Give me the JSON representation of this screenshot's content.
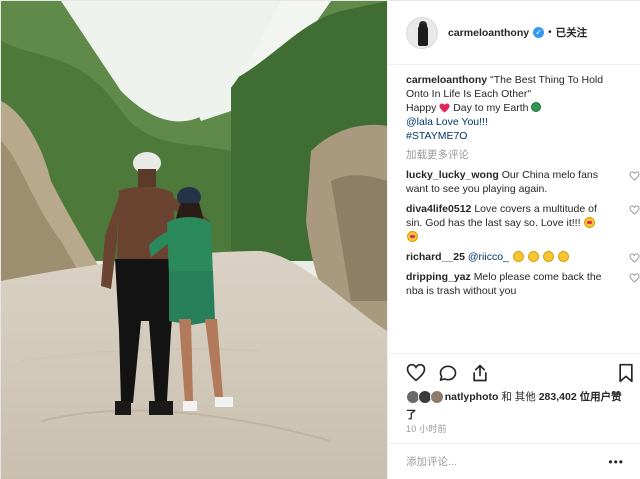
{
  "post": {
    "author": "carmeloanthony",
    "follow_status": "已关注",
    "caption": {
      "username": "carmeloanthony",
      "line1": "\"The Best Thing To Hold Onto In Life Is Each Other\"",
      "line2_pre": "Happy",
      "line2_post": "Day to my Earth",
      "mention_line": "@lala Love You!!!",
      "hashtag": "#STAYME7O"
    },
    "load_more": "加载更多评论",
    "comments": [
      {
        "username": "lucky_lucky_wong",
        "text": "Our China melo fans want to see you playing again."
      },
      {
        "username": "diva4life0512",
        "text": "Love covers a multitude of sin. God has the last say so. Love it!!!"
      },
      {
        "username": "richard__25",
        "mention": "@riicco_",
        "text": ""
      },
      {
        "username": "dripping_yaz",
        "text": "Melo please come back the nba is trash without you"
      }
    ],
    "likes": {
      "liker": "natlyphoto",
      "and_others": "和 其他",
      "count": "283,402",
      "tail": "位用户赞了"
    },
    "timestamp": "10 小时前",
    "add_comment_placeholder": "添加评论...",
    "more": "•••"
  },
  "icons": {
    "header_avatar": "avatar-icon",
    "verified": "verified-badge-icon",
    "like": "heart-icon",
    "comment": "comment-icon",
    "share": "share-icon",
    "save": "bookmark-icon"
  },
  "colors": {
    "link": "#003569",
    "verified": "#3897f0",
    "muted": "#999999",
    "heart_red": "#e0245e"
  }
}
